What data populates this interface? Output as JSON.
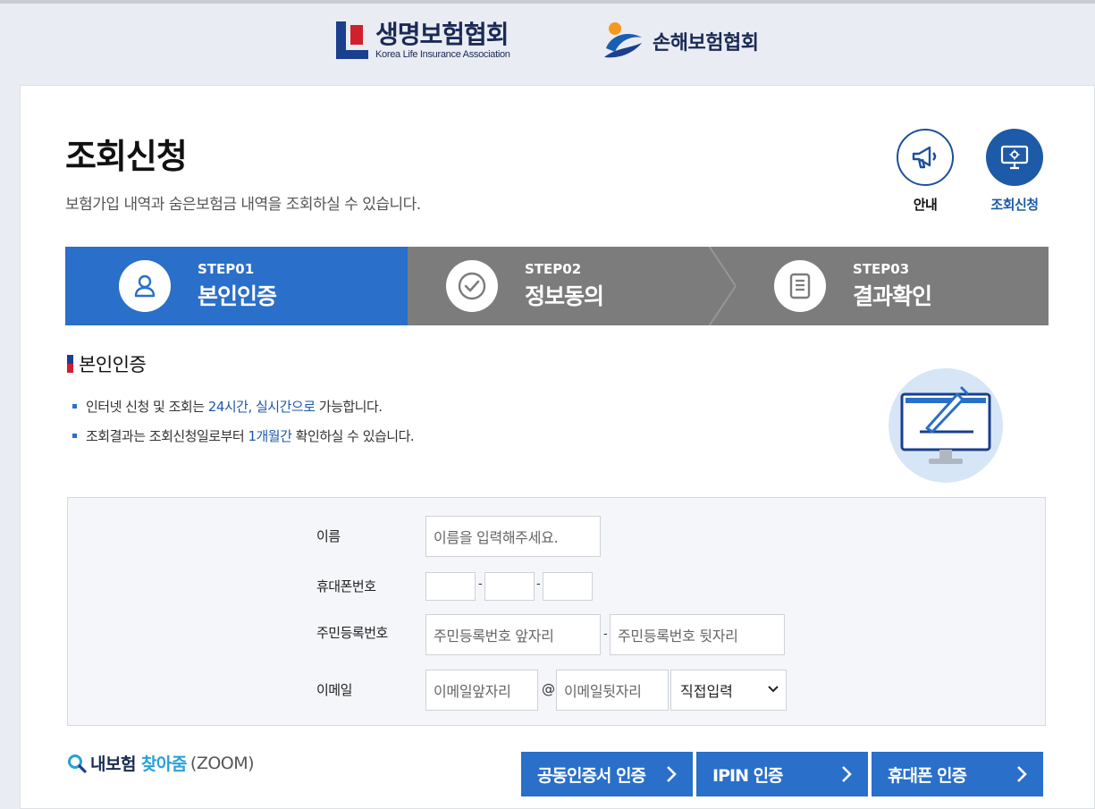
{
  "header": {
    "life_assoc_name": "생명보험협회",
    "life_assoc_en": "Korea Life Insurance Association",
    "general_assoc_name": "손해보험협회"
  },
  "page": {
    "title": "조회신청",
    "description": "보험가입 내역과 숨은보험금 내역을 조회하실 수 있습니다."
  },
  "quick_links": {
    "info_label": "안내",
    "request_label": "조회신청"
  },
  "steps": [
    {
      "num": "STEP01",
      "name": "본인인증",
      "icon": "person-icon"
    },
    {
      "num": "STEP02",
      "name": "정보동의",
      "icon": "check-circle-icon"
    },
    {
      "num": "STEP03",
      "name": "결과확인",
      "icon": "document-icon"
    }
  ],
  "section": {
    "title": "본인인증",
    "bullet1_a": "인터넷 신청 및 조회는 ",
    "bullet1_hl": "24시간, 실시간으로",
    "bullet1_b": " 가능합니다.",
    "bullet2_a": "조회결과는 조회신청일로부터 ",
    "bullet2_hl": "1개월간",
    "bullet2_b": " 확인하실 수 있습니다."
  },
  "form": {
    "name_label": "이름",
    "name_placeholder": "이름을 입력해주세요.",
    "phone_label": "휴대폰번호",
    "rrn_label": "주민등록번호",
    "rrn_front_placeholder": "주민등록번호 앞자리",
    "rrn_back_placeholder": "주민등록번호 뒷자리",
    "email_label": "이메일",
    "email_front_placeholder": "이메일앞자리",
    "email_at": "@",
    "email_back_placeholder": "이메일뒷자리",
    "email_domain_selected": "직접입력",
    "dash": "-"
  },
  "zoom": {
    "part1": "내보험",
    "part2": "찾아줌",
    "part3": "(ZOOM)"
  },
  "buttons": {
    "cert": "공동인증서 인증",
    "ipin": "IPIN 인증",
    "phone": "휴대폰 인증"
  },
  "colors": {
    "accent": "#2a6fc9",
    "navy": "#1a2a55",
    "step_inactive": "#7c7c7c"
  }
}
